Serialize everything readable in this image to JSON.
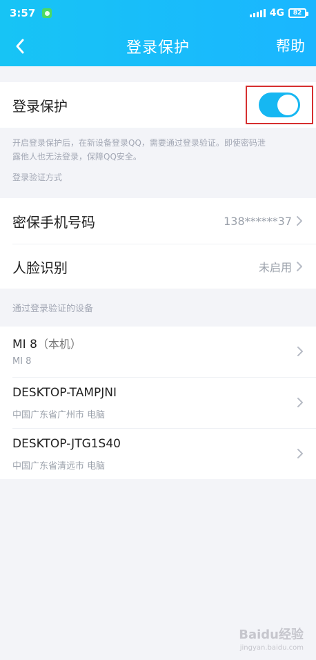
{
  "status": {
    "time": "3:57",
    "network": "4G",
    "battery": "82"
  },
  "header": {
    "title": "登录保护",
    "help": "帮助"
  },
  "protection": {
    "label": "登录保护",
    "enabled": true,
    "description_line1": "开启登录保护后，在新设备登录QQ，需要通过登录验证。即使密码泄",
    "description_line2": "露他人也无法登录，保障QQ安全。",
    "methods_label": "登录验证方式"
  },
  "methods": [
    {
      "label": "密保手机号码",
      "value": "138******37"
    },
    {
      "label": "人脸识别",
      "value": "未启用"
    }
  ],
  "devices_label": "通过登录验证的设备",
  "devices": [
    {
      "name": "MI 8",
      "tag": "（本机）",
      "sub": "MI 8"
    },
    {
      "name": "DESKTOP-TAMPJNI",
      "tag": "",
      "sub": "中国广东省广州市 电脑"
    },
    {
      "name": "DESKTOP-JTG1S40",
      "tag": "",
      "sub": "中国广东省清远市 电脑"
    }
  ],
  "watermark": {
    "brand": "Baidu经验",
    "url": "jingyan.baidu.com"
  },
  "colors": {
    "accent": "#16b7f2",
    "highlight_box": "#d62f2f"
  }
}
